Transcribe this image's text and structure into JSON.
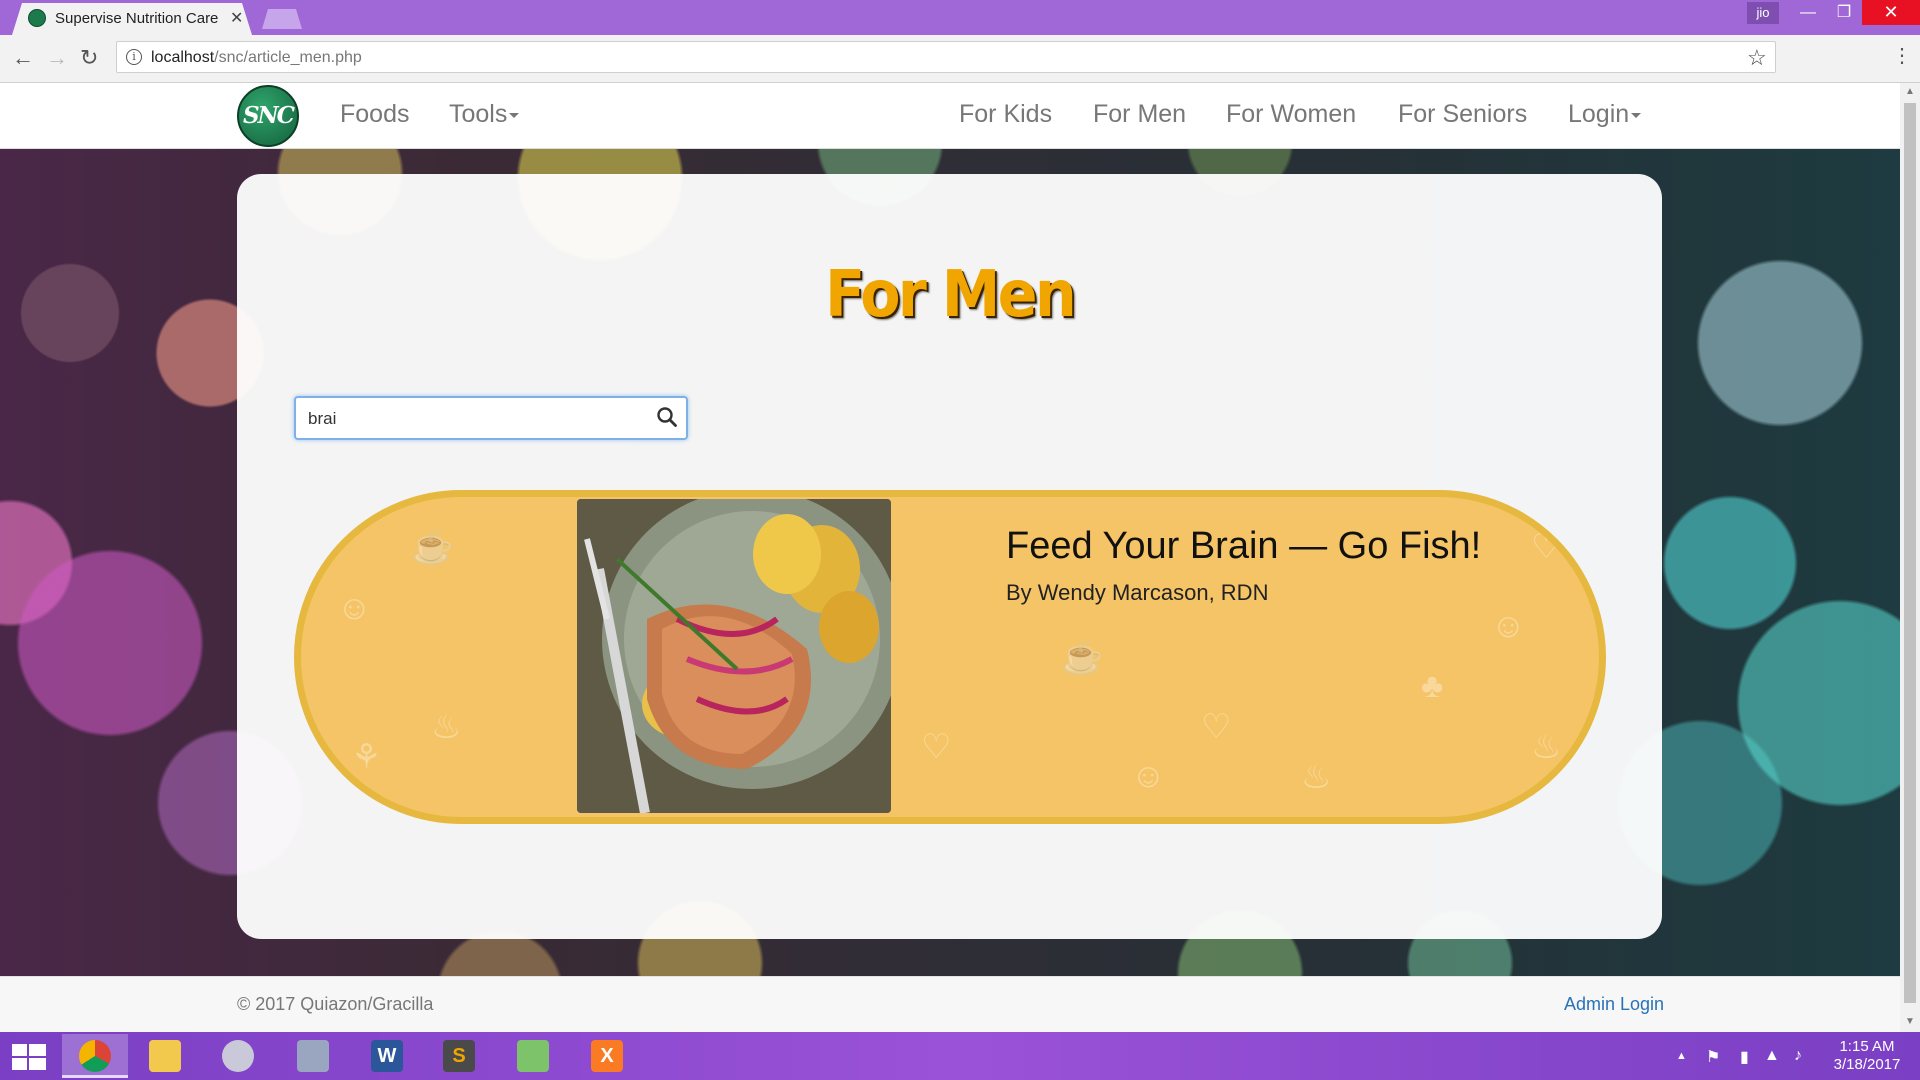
{
  "browser": {
    "tab_title": "Supervise Nutrition Care",
    "url_host": "localhost",
    "url_path": "/snc/article_men.php",
    "profile": "jio"
  },
  "site": {
    "logo_text": "SNC",
    "nav_left": [
      {
        "label": "Foods"
      },
      {
        "label": "Tools"
      }
    ],
    "nav_right": [
      {
        "label": "For Kids"
      },
      {
        "label": "For Men"
      },
      {
        "label": "For Women"
      },
      {
        "label": "For Seniors"
      },
      {
        "label": "Login"
      }
    ]
  },
  "main": {
    "title": "For Men",
    "search_value": "brai",
    "article": {
      "title": "Feed Your Brain — Go Fish!",
      "author": "By Wendy Marcason, RDN"
    }
  },
  "footer": {
    "copyright": "© 2017 Quiazon/Gracilla",
    "admin_link": "Admin Login"
  },
  "taskbar": {
    "time": "1:15 AM",
    "date": "3/18/2017"
  },
  "colors": {
    "accent_title": "#f0a500",
    "card_bg": "#f5c466",
    "card_border": "#e6b840",
    "link": "#2a72b8",
    "browser_frame": "#a068d6"
  }
}
